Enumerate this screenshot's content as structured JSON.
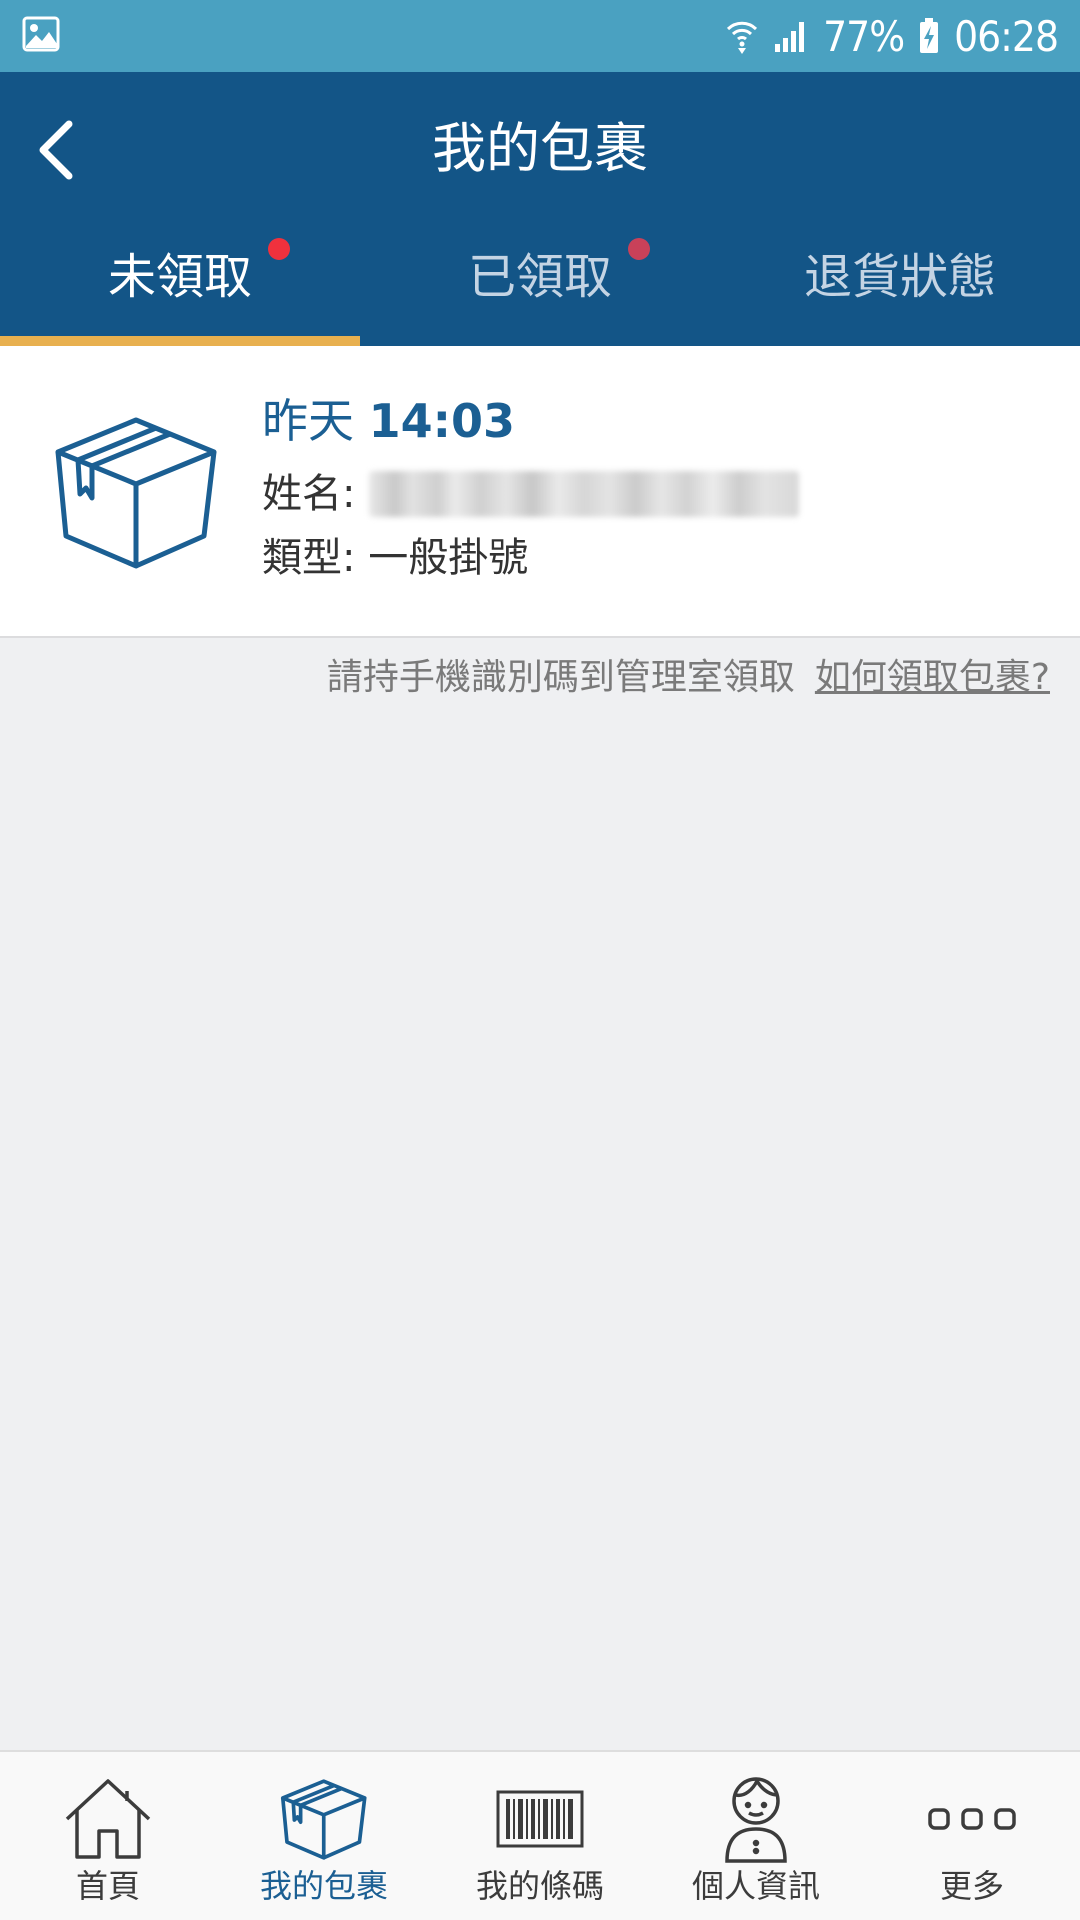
{
  "status_bar": {
    "battery": "77%",
    "time": "06:28"
  },
  "header": {
    "title": "我的包裹",
    "back_icon": "chevron-left-icon"
  },
  "tabs": [
    {
      "label": "未領取",
      "active": true,
      "dot": true,
      "dot_color": "#f0313d"
    },
    {
      "label": "已領取",
      "active": false,
      "dot": true,
      "dot_color": "#c94159"
    },
    {
      "label": "退貨狀態",
      "active": false,
      "dot": false
    }
  ],
  "package": {
    "icon": "package-box-icon",
    "date_label": "昨天",
    "time": "14:03",
    "name_label": "姓名:",
    "type_label": "類型:",
    "type_value": "一般掛號"
  },
  "hint": {
    "text": "請持手機識別碼到管理室領取",
    "link": "如何領取包裹?"
  },
  "bottom_nav": [
    {
      "label": "首頁",
      "icon": "home-icon",
      "active": false
    },
    {
      "label": "我的包裹",
      "icon": "package-box-icon",
      "active": true
    },
    {
      "label": "我的條碼",
      "icon": "barcode-icon",
      "active": false
    },
    {
      "label": "個人資訊",
      "icon": "person-icon",
      "active": false
    },
    {
      "label": "更多",
      "icon": "more-dots-icon",
      "active": false
    }
  ],
  "colors": {
    "status_bar": "#4aa1c1",
    "header": "#135587",
    "tab_indicator": "#e8b04f",
    "accent": "#1b5f93",
    "background": "#eff0f2"
  }
}
